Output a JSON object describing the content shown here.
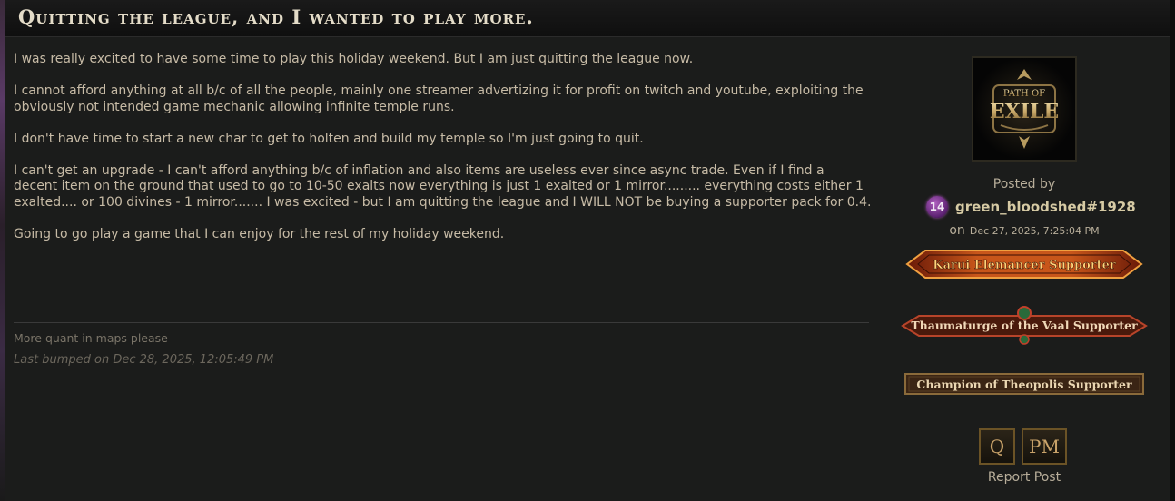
{
  "thread": {
    "title": "Quitting the league, and I wanted to play more."
  },
  "post": {
    "paragraphs": [
      "I was really excited to have some time to play this holiday weekend. But I am just quitting the league now.",
      "I cannot afford anything at all b/c of all the people, mainly one streamer advertizing it for profit on twitch and youtube, exploiting the obviously not intended game mechanic allowing infinite temple runs.",
      "I don't have time to start a new char to get to holten and build my temple so I'm just going to quit.",
      "I can't get an upgrade - I can't afford anything b/c of inflation and also items are useless ever since async trade. Even if I find a decent item on the ground that used to go to 10-50 exalts now everything is just 1 exalted or 1 mirror......... everything costs either 1 exalted.... or 100 divines - 1 mirror....... I was excited - but I am quitting the league and I WILL NOT be buying a supporter pack for 0.4.",
      "Going to go play a game that I can enjoy for the rest of my holiday weekend."
    ],
    "signature": "More quant in maps please",
    "last_bumped": "Last bumped on Dec 28, 2025, 12:05:49 PM"
  },
  "author": {
    "avatar_text_top": "PATH OF",
    "avatar_text_main": "EXILE",
    "posted_by_label": "Posted by",
    "level": "14",
    "username": "green_bloodshed#1928",
    "on_label": "on",
    "date": "Dec 27, 2025, 7:25:04 PM",
    "badges": [
      "Karui Elemancer Supporter",
      "Thaumaturge of the Vaal Supporter",
      "Champion of Theopolis Supporter"
    ]
  },
  "actions": {
    "quote_label": "Q",
    "pm_label": "PM",
    "report_label": "Report Post"
  },
  "colors": {
    "background": "#1b1c1b",
    "text": "#c7bba6",
    "title": "#e4dcc8",
    "username": "#d6caa4",
    "accent_gold": "#c9a36a"
  }
}
